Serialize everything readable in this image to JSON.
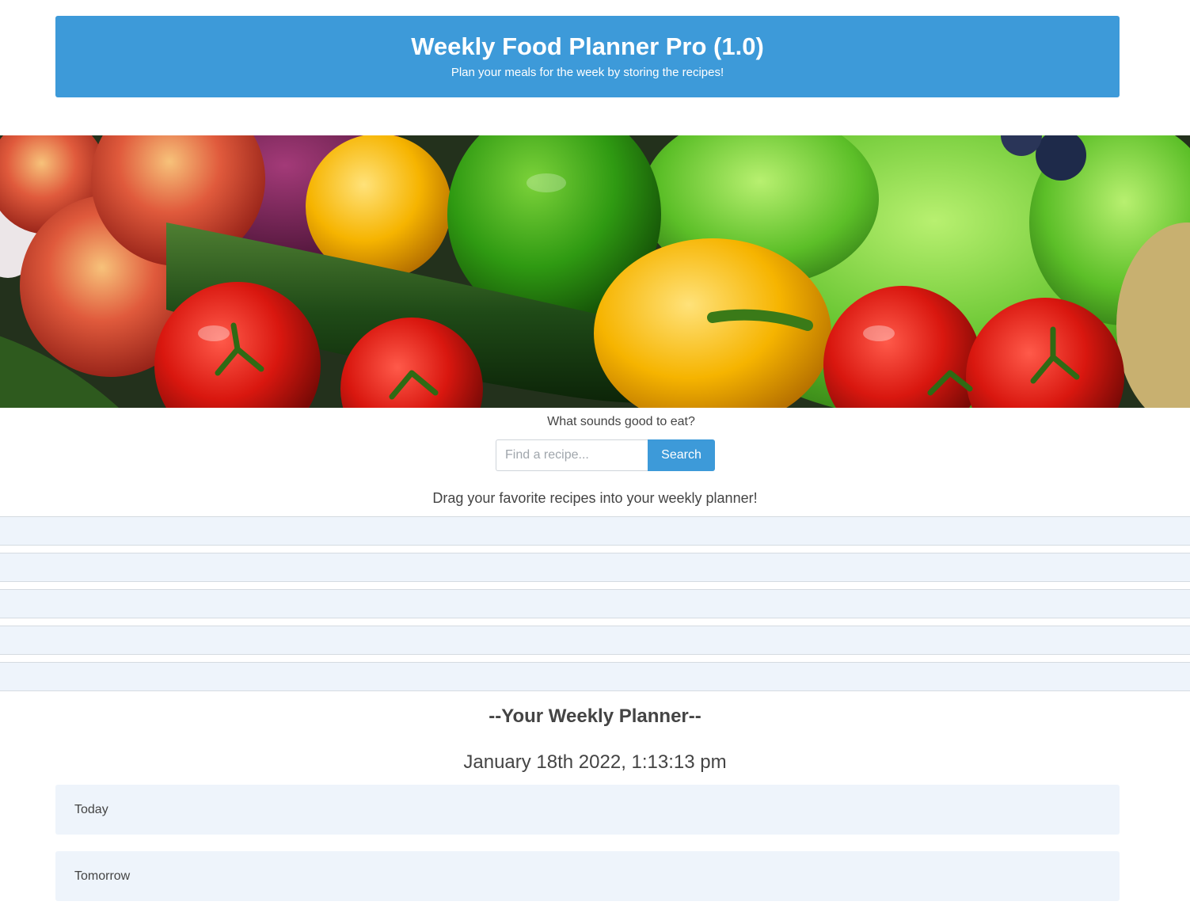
{
  "header": {
    "title": "Weekly Food Planner Pro (1.0)",
    "subtitle": "Plan your meals for the week by storing the recipes!",
    "background_color": "#3d9ad9"
  },
  "hero": {
    "image": "fresh-produce-banner",
    "alt": "Vegetables and fruits banner"
  },
  "search": {
    "prompt": "What sounds good to eat?",
    "placeholder": "Find a recipe...",
    "value": "",
    "button_label": "Search"
  },
  "results": {
    "instruction": "Drag your favorite recipes into your weekly planner!",
    "slots": [
      "",
      "",
      "",
      "",
      ""
    ]
  },
  "planner": {
    "title": "--Your Weekly Planner--",
    "current_datetime": "January 18th 2022, 1:13:13 pm",
    "days": [
      {
        "label": "Today"
      },
      {
        "label": "Tomorrow"
      }
    ]
  },
  "colors": {
    "accent": "#3d9ad9",
    "slot_background": "#eef4fb",
    "text": "#444444"
  }
}
